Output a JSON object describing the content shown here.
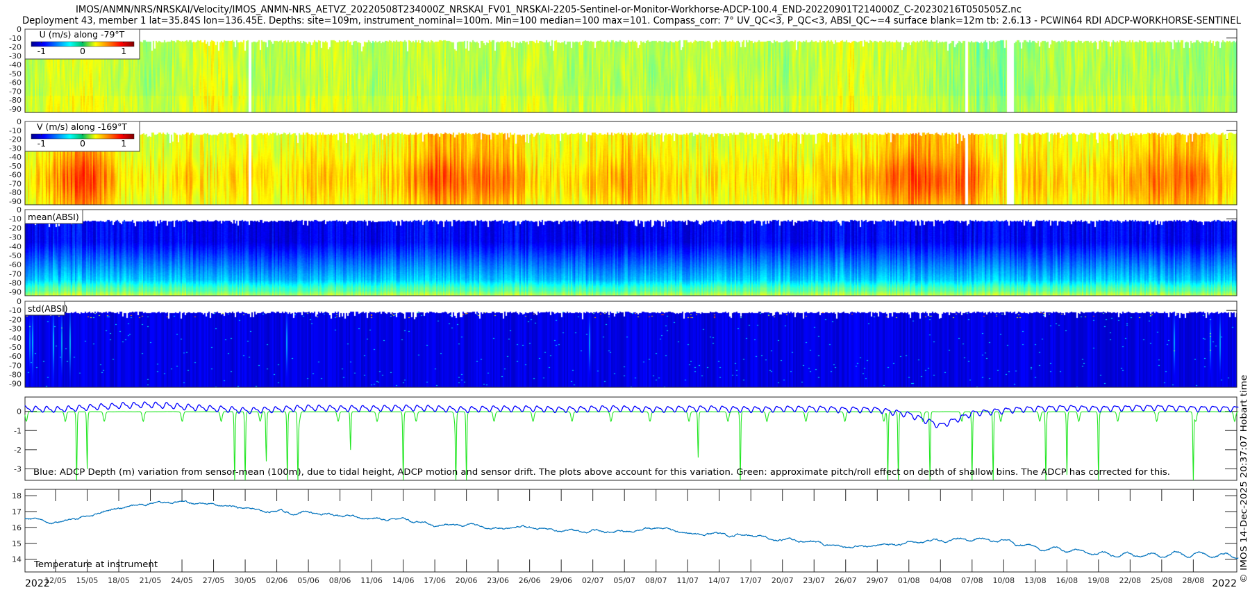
{
  "header": {
    "title_line1": "IMOS/ANMN/NRS/NRSKAI/Velocity/IMOS_ANMN-NRS_AETVZ_20220508T234000Z_NRSKAI_FV01_NRSKAI-2205-Sentinel-or-Monitor-Workhorse-ADCP-100.4_END-20220901T214000Z_C-20230216T050505Z.nc",
    "title_line2": "Deployment 43, member 1 lat=35.84S lon=136.45E. Depths: site=109m, instrument_nominal=100m. Min=100 median=100 max=101. Compass_corr: 7° UV_QC<3, P_QC<3, ABSI_QC~=4 surface blank=12m tb: 2.6.13 - PCWIN64 RDI ADCP-WORKHORSE-SENTINEL"
  },
  "credit": "© IMOS 14-Dec-2025 20:37:07 Hobart time",
  "time_axis": {
    "xlim": [
      "2022-05-09T02:00",
      "2022-09-01T07:40"
    ],
    "year_label_left": "2022",
    "year_label_right": "2022",
    "tick_labels": [
      "12/05",
      "15/05",
      "18/05",
      "21/05",
      "24/05",
      "27/05",
      "30/05",
      "02/06",
      "05/06",
      "08/06",
      "11/06",
      "14/06",
      "17/06",
      "20/06",
      "23/06",
      "26/06",
      "29/06",
      "02/07",
      "05/07",
      "08/07",
      "11/07",
      "14/07",
      "17/07",
      "20/07",
      "23/07",
      "26/07",
      "29/07",
      "01/08",
      "04/08",
      "07/08",
      "10/08",
      "13/08",
      "16/08",
      "19/08",
      "22/08",
      "25/08",
      "28/08"
    ]
  },
  "chart_data": [
    {
      "type": "heatmap",
      "label": "U (m/s) along -79°T",
      "colormap": "jet",
      "colorbar": {
        "clim": [
          -1.25,
          1.25
        ],
        "ticks": [
          -1,
          0,
          1
        ],
        "tick_labels": [
          "-1",
          "0",
          "1"
        ]
      },
      "y_ticks": [
        0,
        -10,
        -20,
        -30,
        -40,
        -50,
        -60,
        -70,
        -80,
        -90
      ],
      "ylim": [
        -94,
        0
      ],
      "typical_values": {
        "dates": [
          "09/05",
          "12/05",
          "15/05",
          "18/05",
          "21/05",
          "24/05",
          "27/05",
          "30/05",
          "02/06",
          "05/06",
          "08/06",
          "11/06",
          "14/06",
          "17/06",
          "20/06",
          "23/06",
          "26/06",
          "29/06",
          "02/07",
          "05/07",
          "08/07",
          "11/07",
          "14/07",
          "17/07",
          "20/07",
          "23/07",
          "26/07",
          "29/07",
          "01/08",
          "04/08",
          "07/08",
          "10/08",
          "13/08",
          "16/08",
          "19/08",
          "22/08",
          "25/08",
          "28/08",
          "01/09"
        ],
        "values": [
          0.15,
          0.2,
          0.25,
          0.15,
          0.1,
          0.2,
          0.25,
          0.15,
          0.1,
          0.15,
          0.2,
          0.1,
          0.15,
          0.2,
          0.15,
          0.15,
          0.2,
          0.1,
          0.15,
          0.15,
          0.1,
          0.15,
          0.2,
          0.15,
          0.1,
          0.15,
          0.25,
          0.15,
          0.2,
          0.1,
          0.05,
          0.0,
          0.1,
          0.1,
          0.1,
          0.15,
          0.1,
          0.1,
          0.1
        ]
      },
      "gaps": [
        "30/05",
        "06/08",
        "10/08"
      ]
    },
    {
      "type": "heatmap",
      "label": "V (m/s) along -169°T",
      "colormap": "jet",
      "colorbar": {
        "clim": [
          -1.25,
          1.25
        ],
        "ticks": [
          -1,
          0,
          1
        ],
        "tick_labels": [
          "-1",
          "0",
          "1"
        ]
      },
      "y_ticks": [
        0,
        -10,
        -20,
        -30,
        -40,
        -50,
        -60,
        -70,
        -80,
        -90
      ],
      "ylim": [
        -94,
        0
      ],
      "typical_values": {
        "dates": [
          "09/05",
          "12/05",
          "15/05",
          "18/05",
          "21/05",
          "24/05",
          "27/05",
          "30/05",
          "02/06",
          "05/06",
          "08/06",
          "11/06",
          "14/06",
          "17/06",
          "20/06",
          "23/06",
          "26/06",
          "29/06",
          "02/07",
          "05/07",
          "08/07",
          "11/07",
          "14/07",
          "17/07",
          "20/07",
          "23/07",
          "26/07",
          "29/07",
          "01/08",
          "04/08",
          "07/08",
          "10/08",
          "13/08",
          "16/08",
          "19/08",
          "22/08",
          "25/08",
          "28/08",
          "01/09"
        ],
        "values": [
          0.3,
          0.5,
          0.75,
          0.35,
          0.3,
          0.4,
          0.3,
          0.35,
          0.3,
          0.4,
          0.35,
          0.3,
          0.45,
          0.7,
          0.55,
          0.6,
          0.4,
          0.3,
          0.4,
          0.5,
          0.35,
          0.3,
          0.35,
          0.3,
          0.4,
          0.3,
          0.45,
          0.5,
          0.7,
          0.65,
          0.6,
          0.35,
          0.4,
          0.3,
          0.35,
          0.5,
          0.6,
          0.55,
          0.35
        ]
      },
      "gaps": [
        "30/05",
        "06/08",
        "10/08"
      ]
    },
    {
      "type": "heatmap",
      "label": "mean(ABSI)",
      "colormap": "jet",
      "y_ticks": [
        0,
        -10,
        -20,
        -30,
        -40,
        -50,
        -60,
        -70,
        -80,
        -90
      ],
      "ylim": [
        -94,
        0
      ]
    },
    {
      "type": "heatmap",
      "label": "std(ABSI)",
      "colormap": "jet",
      "y_ticks": [
        0,
        -10,
        -20,
        -30,
        -40,
        -50,
        -60,
        -70,
        -80,
        -90
      ],
      "ylim": [
        -94,
        0
      ]
    },
    {
      "type": "line",
      "annotation": "Blue: ADCP Depth (m) variation from sensor-mean (100m), due to tidal height, ADCP motion and sensor drift. The plots above account for this variation. Green: approximate pitch/roll effect on depth of shallow bins. The ADCP has corrected for this.",
      "y_ticks": [
        0,
        -1,
        -2,
        -3
      ],
      "y_tick_labels": [
        "0",
        "-1",
        "-2",
        "-3"
      ],
      "ylim": [
        -3.6,
        0.75
      ],
      "colors": {
        "depth_variation": "#0000ff",
        "pitch_roll_effect": "#22e622"
      },
      "depth_variation": {
        "dates": [
          "09/05",
          "12/05",
          "15/05",
          "18/05",
          "21/05",
          "24/05",
          "27/05",
          "30/05",
          "02/06",
          "05/06",
          "08/06",
          "11/06",
          "14/06",
          "17/06",
          "20/06",
          "23/06",
          "26/06",
          "29/06",
          "02/07",
          "05/07",
          "08/07",
          "11/07",
          "14/07",
          "17/07",
          "20/07",
          "23/07",
          "26/07",
          "29/07",
          "01/08",
          "04/08",
          "07/08",
          "10/08",
          "13/08",
          "16/08",
          "19/08",
          "22/08",
          "25/08",
          "28/08",
          "01/09"
        ],
        "values": [
          0.15,
          0.1,
          0.2,
          0.3,
          0.35,
          0.25,
          0.15,
          0.05,
          0.1,
          0.2,
          0.15,
          0.15,
          0.2,
          0.15,
          0.1,
          0.15,
          0.15,
          0.1,
          0.15,
          0.15,
          0.1,
          0.15,
          0.15,
          0.1,
          0.15,
          0.15,
          0.1,
          0.1,
          -0.15,
          -0.75,
          -0.1,
          0.05,
          0.15,
          0.2,
          0.15,
          0.2,
          0.2,
          0.15,
          0.15
        ]
      },
      "pitch_roll_spikes": {
        "dates": [
          "14/05",
          "15/05",
          "29/05",
          "30/05",
          "01/06",
          "03/06",
          "04/06",
          "09/06",
          "14/06",
          "19/06",
          "20/06",
          "12/07",
          "16/07",
          "30/07",
          "31/07",
          "03/08",
          "07/08",
          "09/08",
          "14/08",
          "16/08",
          "19/08",
          "28/08"
        ],
        "values": [
          -3.6,
          -3.0,
          -3.6,
          -3.6,
          -2.6,
          -3.6,
          -3.6,
          -2.0,
          -3.6,
          -3.6,
          -3.6,
          -2.4,
          -3.6,
          -3.6,
          -3.6,
          -3.6,
          -3.6,
          -3.6,
          -3.6,
          -3.3,
          -3.6,
          -3.6
        ]
      }
    },
    {
      "type": "line",
      "annotation": "Temperature at instrument",
      "y_ticks": [
        14,
        15,
        16,
        17,
        18
      ],
      "y_tick_labels": [
        "14",
        "15",
        "16",
        "17",
        "18"
      ],
      "ylim": [
        13.2,
        18.4
      ],
      "color": "#0072bd",
      "temperature": {
        "dates": [
          "09/05",
          "12/05",
          "15/05",
          "18/05",
          "21/05",
          "24/05",
          "27/05",
          "30/05",
          "02/06",
          "05/06",
          "08/06",
          "11/06",
          "14/06",
          "17/06",
          "20/06",
          "23/06",
          "26/06",
          "29/06",
          "02/07",
          "05/07",
          "08/07",
          "11/07",
          "14/07",
          "17/07",
          "20/07",
          "23/07",
          "26/07",
          "29/07",
          "01/08",
          "04/08",
          "07/08",
          "10/08",
          "13/08",
          "16/08",
          "19/08",
          "22/08",
          "25/08",
          "28/08",
          "01/09"
        ],
        "values": [
          16.6,
          16.3,
          16.65,
          17.25,
          17.55,
          17.6,
          17.4,
          17.2,
          17.0,
          16.97,
          16.75,
          16.5,
          16.6,
          16.1,
          16.15,
          15.95,
          16.0,
          15.8,
          15.75,
          15.75,
          16.0,
          15.65,
          15.55,
          15.5,
          15.2,
          15.1,
          14.75,
          14.85,
          15.05,
          15.2,
          15.25,
          15.15,
          14.75,
          14.6,
          14.35,
          14.25,
          14.3,
          14.35,
          14.2
        ]
      }
    }
  ]
}
